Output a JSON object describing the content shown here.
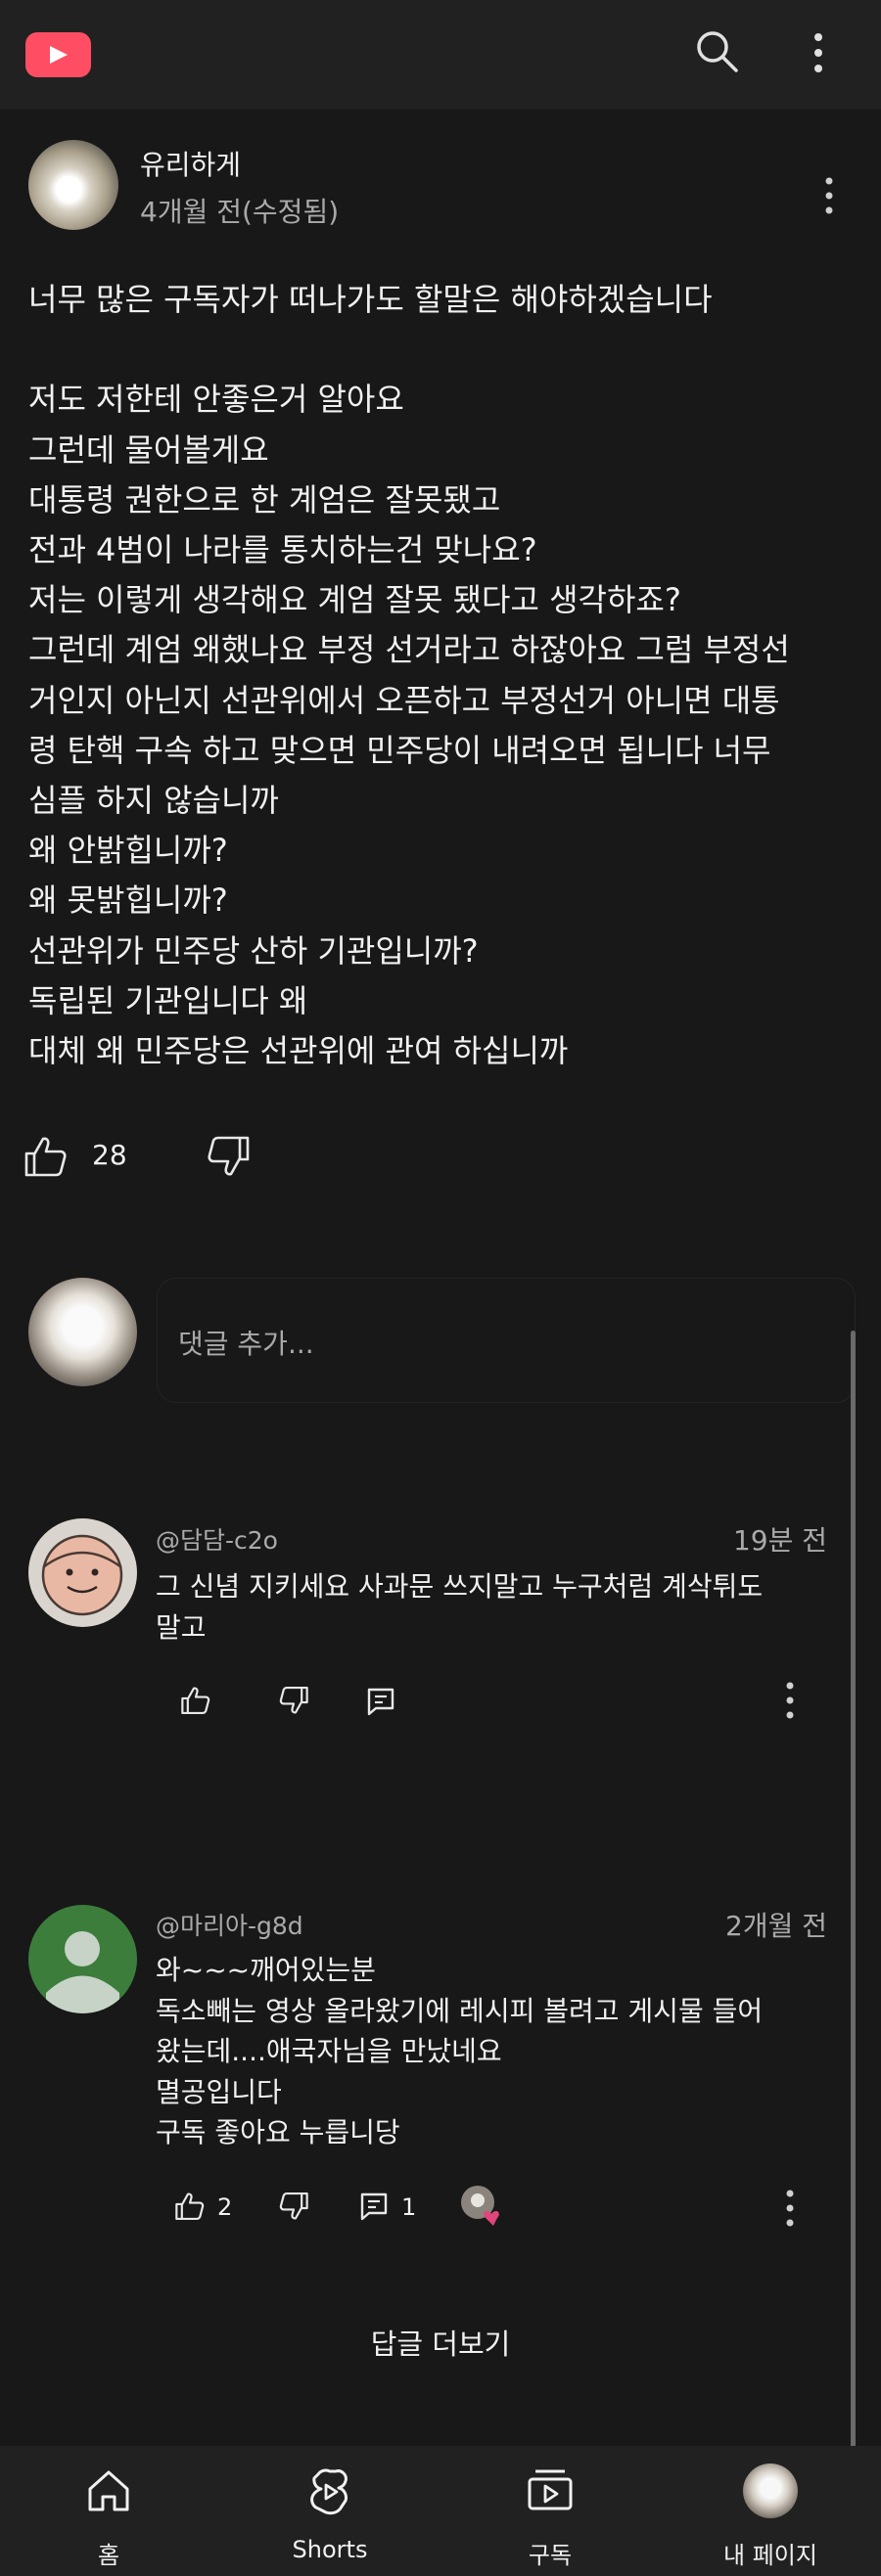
{
  "header": {
    "logo_icon": "play-logo-icon",
    "search_icon": "search-icon",
    "menu_icon": "more-vert-icon"
  },
  "post": {
    "author": "유리하게",
    "time": "4개월 전(수정됨)",
    "lines": [
      "너무 많은 구독자가 떠나가도 할말은 해야하겠습니다",
      "",
      "저도 저한테 안좋은거 알아요",
      "그런데 물어볼게요",
      "대통령 권한으로 한 계엄은 잘못됐고",
      "전과 4범이 나라를 통치하는건 맞나요?",
      "저는 이렇게 생각해요 계엄 잘못 됐다고 생각하죠?",
      "그런데 계엄 왜했나요 부정 선거라고 하잖아요 그럼 부정선",
      "거인지 아닌지 선관위에서 오픈하고  부정선거 아니면 대통",
      "령 탄핵 구속 하고 맞으면 민주당이 내려오면 됩니다 너무",
      "심플 하지 않습니까",
      "왜 안밝힙니까?",
      "왜 못밝힙니까?",
      "선관위가 민주당 산하 기관입니까?",
      "독립된 기관입니다 왜",
      "대체 왜 민주당은 선관위에 관여 하십니까"
    ],
    "likes": "28"
  },
  "add_comment": {
    "placeholder": "댓글 추가..."
  },
  "comments": [
    {
      "user": "@담담-c2o",
      "time": "19분 전",
      "lines": [
        "그 신념 지키세요 사과문 쓰지말고 누구처럼 계삭튀도",
        "말고"
      ]
    },
    {
      "user": "@마리아-g8d",
      "time": "2개월 전",
      "lines": [
        "와~~~깨어있는분",
        "독소빼는 영상 올라왔기에  레시피 볼려고 게시물 들어",
        "왔는데....애국자님을 만났네요",
        "멸공입니다",
        "구독 좋아요 누릅니당"
      ],
      "likes": "2",
      "replies": "1"
    }
  ],
  "more_replies": "답글 더보기",
  "nav": {
    "home": "홈",
    "shorts": "Shorts",
    "subscriptions": "구독",
    "my_page": "내 페이지"
  },
  "colors": {
    "background": "#181818",
    "bars": "#212121",
    "brand": "#ff4e63",
    "heart": "#e0457b"
  }
}
